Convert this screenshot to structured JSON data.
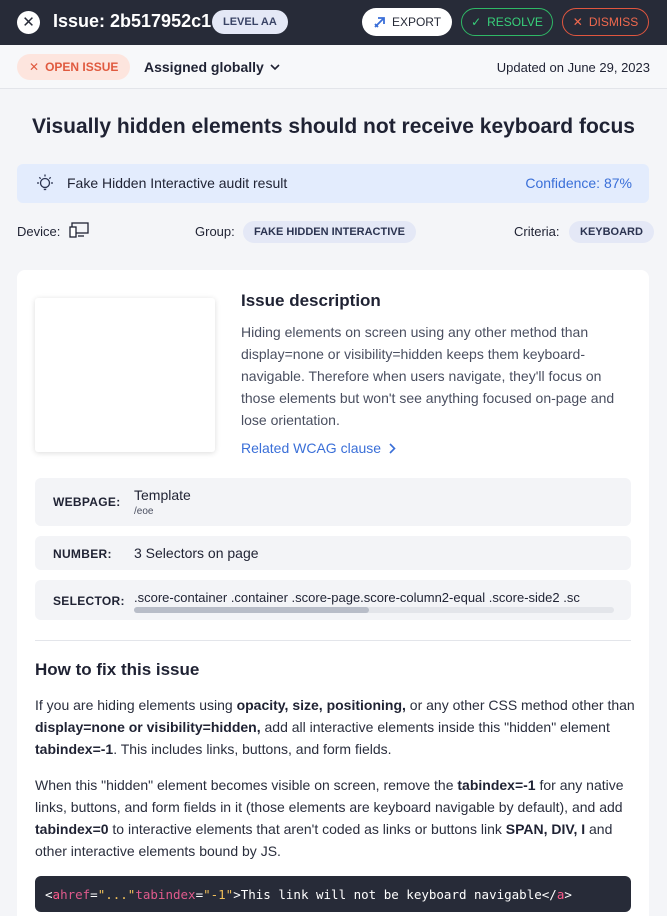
{
  "header": {
    "close_icon": "close-icon",
    "issue_title": "Issue: 2b517952c1",
    "level": "LEVEL AA",
    "export_label": "EXPORT",
    "resolve_label": "RESOLVE",
    "dismiss_label": "DISMISS"
  },
  "status": {
    "open_label": "OPEN ISSUE",
    "assigned_label": "Assigned globally",
    "updated": "Updated on June 29, 2023"
  },
  "heading": "Visually hidden elements should not receive keyboard focus",
  "audit": {
    "text": "Fake Hidden Interactive audit result",
    "confidence": "Confidence: 87%"
  },
  "meta": {
    "device_label": "Device:",
    "group_label": "Group:",
    "group_value": "FAKE HIDDEN INTERACTIVE",
    "criteria_label": "Criteria:",
    "criteria_value": "KEYBOARD"
  },
  "description": {
    "title": "Issue description",
    "text": "Hiding elements on screen using any other method than display=none or visibility=hidden keeps them keyboard-navigable. Therefore when users navigate, they'll focus on those elements but won't see anything focused on-page and lose orientation.",
    "link": "Related WCAG clause"
  },
  "details": {
    "webpage_label": "WEBPAGE:",
    "webpage_value": "Template",
    "webpage_path": "/eoe",
    "number_label": "NUMBER:",
    "number_value": "3 Selectors on page",
    "selector_label": "SELECTOR:",
    "selector_value": ".score-container .container .score-page.score-column2-equal .score-side2 .sc",
    "selector_scroll_fraction": 0.49
  },
  "fix": {
    "title": "How to fix this issue",
    "p1_a": "If you are hiding elements using ",
    "p1_b": "opacity, size, positioning,",
    "p1_c": " or any other CSS method other than ",
    "p1_d": "display=none or visibility=hidden,",
    "p1_e": " add all interactive elements inside this \"hidden\" element ",
    "p1_f": "tabindex=-1",
    "p1_g": ". This includes links, buttons, and form fields.",
    "p2_a": "When this \"hidden\" element becomes visible on screen, remove the ",
    "p2_b": "tabindex=-1",
    "p2_c": " for any native links, buttons, and form fields in it (those elements are keyboard navigable by default), and add ",
    "p2_d": "tabindex=0",
    "p2_e": " to interactive elements that aren't coded as links or buttons link ",
    "p2_f": "SPAN, DIV, I",
    "p2_g": " and other interactive elements bound by JS.",
    "code": {
      "open": "<",
      "tag": "a",
      "attr1": " href",
      "eq1": "=",
      "val1": "\"...\"",
      "attr2": " tabindex",
      "eq2": "=",
      "val2": "\"-1\"",
      "gt": ">",
      "text": "This link will not be keyboard navigable",
      "close_open": "</",
      "close_tag": "a",
      "close_gt": ">"
    }
  },
  "colors": {
    "topbar": "#272b38",
    "resolve": "#38d07a",
    "dismiss": "#f0694e",
    "link": "#3a6fd8",
    "open_badge_bg": "#fde5de"
  }
}
